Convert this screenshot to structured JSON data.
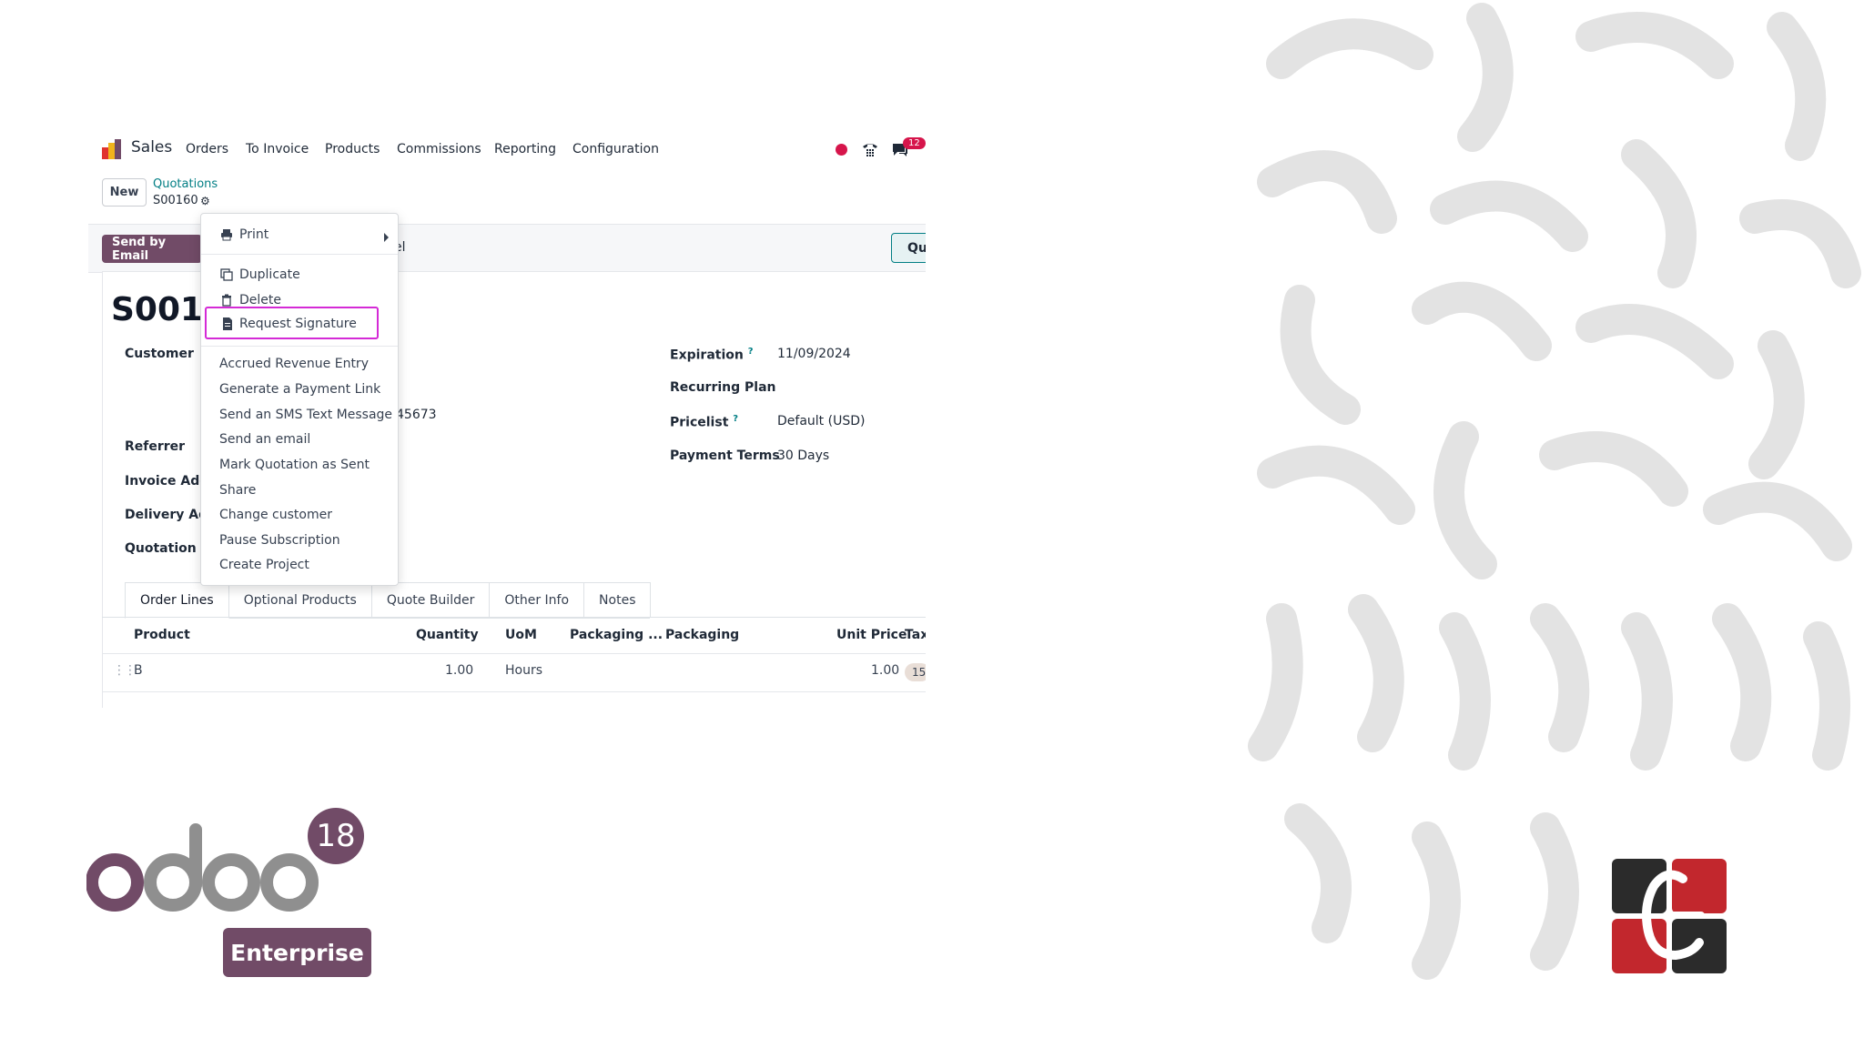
{
  "nav": {
    "app_name": "Sales",
    "menu": [
      "Orders",
      "To Invoice",
      "Products",
      "Commissions",
      "Reporting",
      "Configuration"
    ],
    "chat_badge": "12"
  },
  "control": {
    "new_label": "New",
    "breadcrumb_parent": "Quotations",
    "breadcrumb_current": "S00160"
  },
  "statusbar": {
    "send_email_label": "Send by Email",
    "cancel_fragment": "el",
    "quotation_fragment": "Qu"
  },
  "form": {
    "title_fragment": "S001(",
    "customer_label": "Customer",
    "phone_fragment": "45673",
    "referrer_label": "Referrer",
    "invoice_address_label": "Invoice Addr",
    "delivery_address_label": "Delivery Add",
    "quotation_template_label": "Quotation Te",
    "expiration_label": "Expiration",
    "expiration_value": "11/09/2024",
    "recurring_plan_label": "Recurring Plan",
    "pricelist_label": "Pricelist",
    "pricelist_value": "Default (USD)",
    "payment_terms_label": "Payment Terms",
    "payment_terms_value": "30 Days",
    "help_mark": "?"
  },
  "tabs": [
    "Order Lines",
    "Optional Products",
    "Quote Builder",
    "Other Info",
    "Notes"
  ],
  "table": {
    "headers": [
      "Product",
      "Quantity",
      "UoM",
      "Packaging ...",
      "Packaging",
      "Unit Price",
      "Tax"
    ],
    "rows": [
      {
        "product": "B",
        "quantity": "1.00",
        "uom": "Hours",
        "unit_price": "1.00",
        "tax": "15"
      }
    ]
  },
  "dropdown": {
    "print": "Print",
    "duplicate": "Duplicate",
    "delete": "Delete",
    "request_signature": "Request Signature",
    "actions": [
      "Accrued Revenue Entry",
      "Generate a Payment Link",
      "Send an SMS Text Message",
      "Send an email",
      "Mark Quotation as Sent",
      "Share",
      "Change customer",
      "Pause Subscription",
      "Create Project"
    ]
  },
  "branding": {
    "version": "18",
    "edition": "Enterprise",
    "odoo_text": "odoo",
    "colors": {
      "odoo_purple": "#714b67",
      "odoo_grey": "#8f8f8f",
      "teal": "#017e84",
      "highlight": "#d42ad6"
    }
  }
}
